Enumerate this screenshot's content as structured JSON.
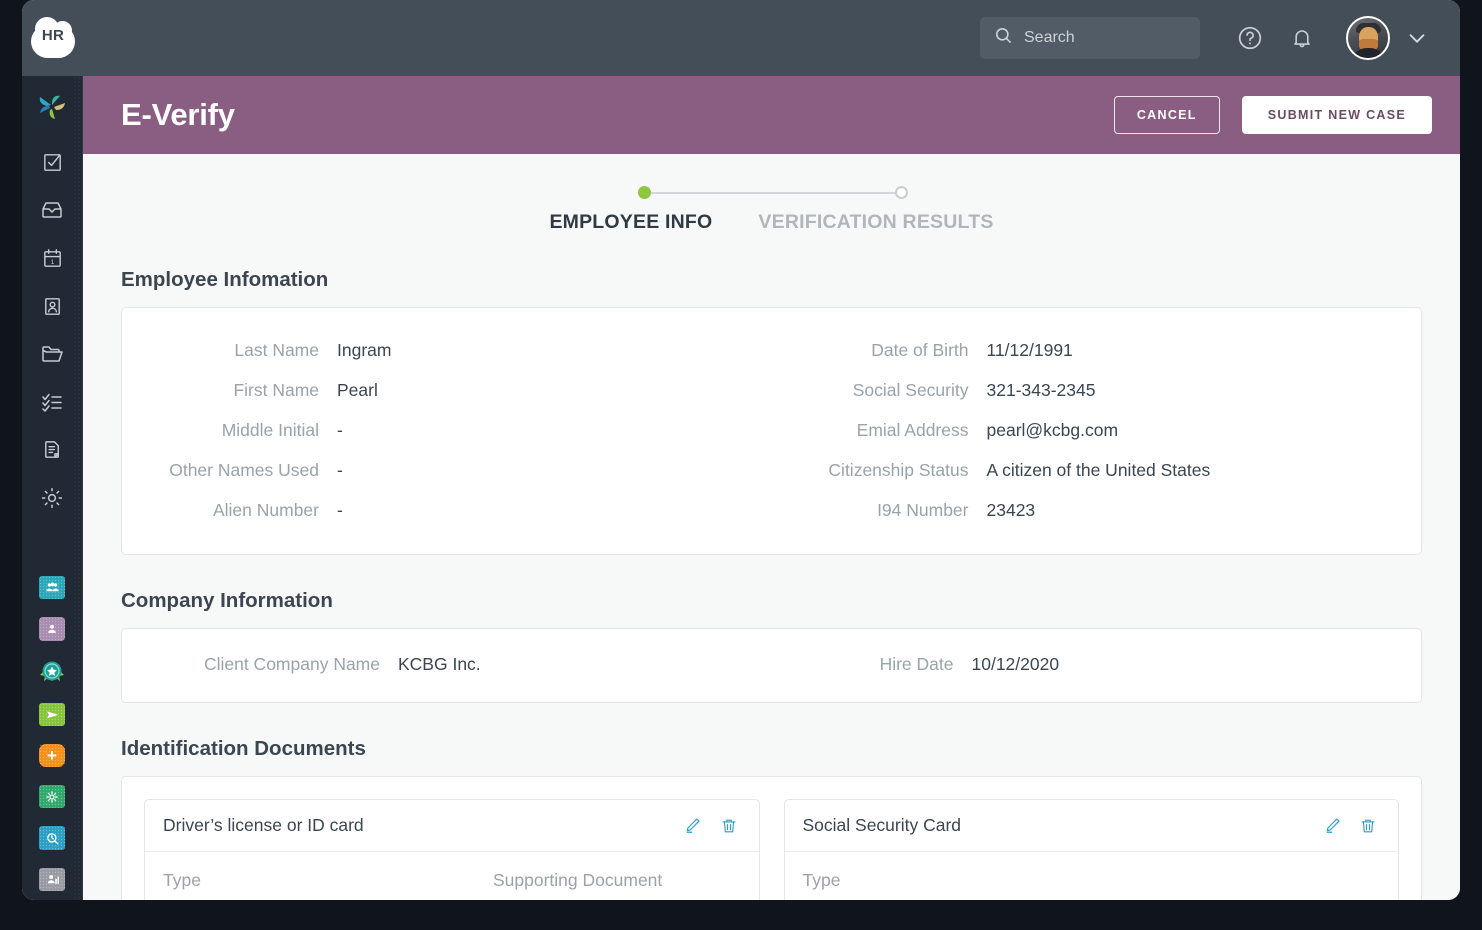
{
  "topbar": {
    "logo_text": "HR",
    "logo_name": "hr-cloud-logo",
    "search_placeholder": "Search",
    "search_value": "",
    "help_icon": "help-circle-icon",
    "notifications_icon": "bell-icon",
    "avatar_name": "user-avatar",
    "caret_icon": "chevron-down-icon"
  },
  "sidebar": {
    "brand_icon": "pinwheel-logo-icon",
    "nav_items": [
      {
        "icon": "checkbox-task-icon"
      },
      {
        "icon": "inbox-tray-icon"
      },
      {
        "icon": "calendar-icon"
      },
      {
        "icon": "id-badge-person-icon"
      },
      {
        "icon": "folder-icon"
      },
      {
        "icon": "checklist-icon"
      },
      {
        "icon": "document-page-icon"
      },
      {
        "icon": "gear-settings-icon"
      }
    ],
    "app_items": [
      {
        "icon": "people-directory-app-icon",
        "glyph": "♟",
        "color": "#2aa8b8"
      },
      {
        "icon": "clipboard-person-app-icon",
        "glyph": "♟",
        "color": "#a98cb0"
      },
      {
        "icon": "award-badge-app-icon",
        "glyph": "★",
        "color": "#23a6a0"
      },
      {
        "icon": "time-off-calendar-app-icon",
        "glyph": "✈",
        "color": "#88c43b"
      },
      {
        "icon": "add-plus-app-icon",
        "glyph": "+",
        "color": "#f3911c"
      },
      {
        "icon": "benefits-monitor-app-icon",
        "glyph": "⚙",
        "color": "#2fa96b"
      },
      {
        "icon": "time-tracking-app-icon",
        "glyph": "⏱",
        "color": "#2b9fc4"
      },
      {
        "icon": "reports-person-app-icon",
        "glyph": "♟",
        "color": "#9a9aa4"
      }
    ]
  },
  "page_header": {
    "title": "E-Verify",
    "cancel_label": "CANCEL",
    "submit_label": "SUBMIT NEW CASE",
    "background_color": "#8a5e82"
  },
  "stepper": {
    "steps": [
      {
        "label": "EMPLOYEE INFO",
        "state": "active",
        "dot_color": "#8dc63f"
      },
      {
        "label": "VERIFICATION RESULTS",
        "state": "inactive",
        "dot_color": "#ffffff"
      }
    ]
  },
  "employee_section": {
    "title": "Employee Infomation",
    "left_fields": [
      {
        "label": "Last Name",
        "value": "Ingram"
      },
      {
        "label": "First Name",
        "value": "Pearl"
      },
      {
        "label": "Middle Initial",
        "value": "-"
      },
      {
        "label": "Other Names Used",
        "value": "-"
      },
      {
        "label": "Alien Number",
        "value": "-"
      }
    ],
    "right_fields": [
      {
        "label": "Date of Birth",
        "value": "11/12/1991"
      },
      {
        "label": "Social Security",
        "value": "321-343-2345"
      },
      {
        "label": "Emial Address",
        "value": "pearl@kcbg.com"
      },
      {
        "label": "Citizenship Status",
        "value": "A citizen of the United States"
      },
      {
        "label": "I94 Number",
        "value": "23423"
      }
    ]
  },
  "company_section": {
    "title": "Company Information",
    "left_fields": [
      {
        "label": "Client Company Name",
        "value": "KCBG Inc."
      }
    ],
    "right_fields": [
      {
        "label": "Hire Date",
        "value": "10/12/2020"
      }
    ]
  },
  "documents_section": {
    "title": "Identification Documents",
    "documents": [
      {
        "title": "Driver’s license or ID card",
        "edit_icon": "edit-pencil-icon",
        "delete_icon": "trash-delete-icon",
        "cells": [
          "Type",
          "Supporting Document"
        ]
      },
      {
        "title": "Social Security Card",
        "edit_icon": "edit-pencil-icon",
        "delete_icon": "trash-delete-icon",
        "cells": [
          "Type"
        ]
      }
    ]
  }
}
